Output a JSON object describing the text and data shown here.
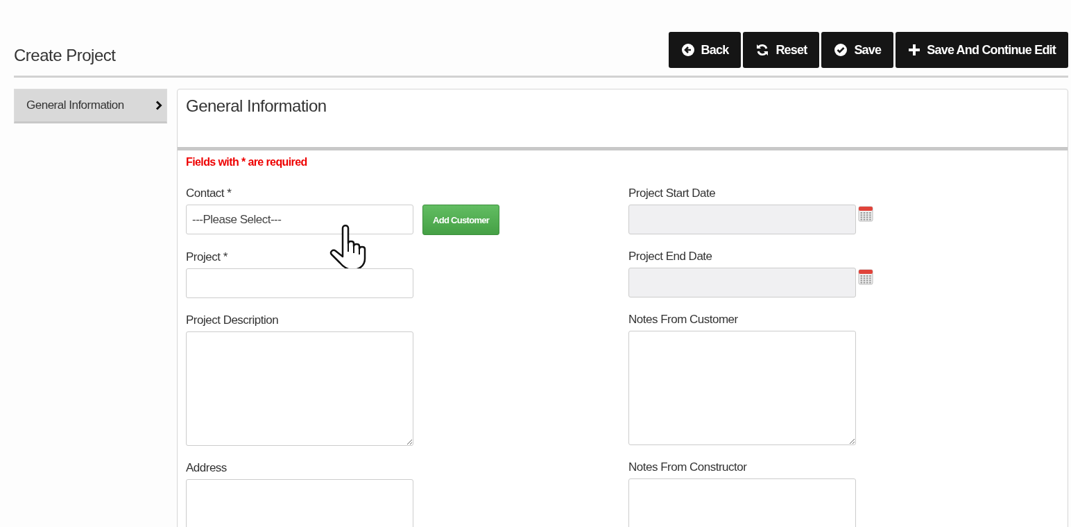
{
  "page": {
    "title": "Create Project"
  },
  "actions": [
    {
      "label": "Back",
      "kind": "back"
    },
    {
      "label": "Reset",
      "kind": "reset"
    },
    {
      "label": "Save",
      "kind": "save"
    },
    {
      "label": "Save And Continue Edit",
      "kind": "plus"
    }
  ],
  "sidebar": {
    "items": [
      {
        "label": "General Information",
        "selected": true
      }
    ]
  },
  "panel": {
    "title": "General Information",
    "required_note": "Fields with * are required",
    "columns": [
      [
        {
          "label": "Contact *",
          "kind": "select",
          "value": "---Please Select---",
          "disabled": false,
          "button": "Add Customer"
        },
        {
          "label": "Project *",
          "kind": "text",
          "disabled": false
        },
        {
          "label": "Project Description",
          "kind": "textarea",
          "disabled": false
        },
        {
          "label": "Address",
          "kind": "textarea",
          "disabled": false
        }
      ],
      [
        {
          "label": "Project Start Date",
          "kind": "date",
          "disabled": true
        },
        {
          "label": "Project End Date",
          "kind": "date",
          "disabled": true
        },
        {
          "label": "Notes From Customer",
          "kind": "textarea",
          "disabled": false
        },
        {
          "label": "Notes From Constructor",
          "kind": "textarea",
          "disabled": false
        }
      ]
    ]
  }
}
